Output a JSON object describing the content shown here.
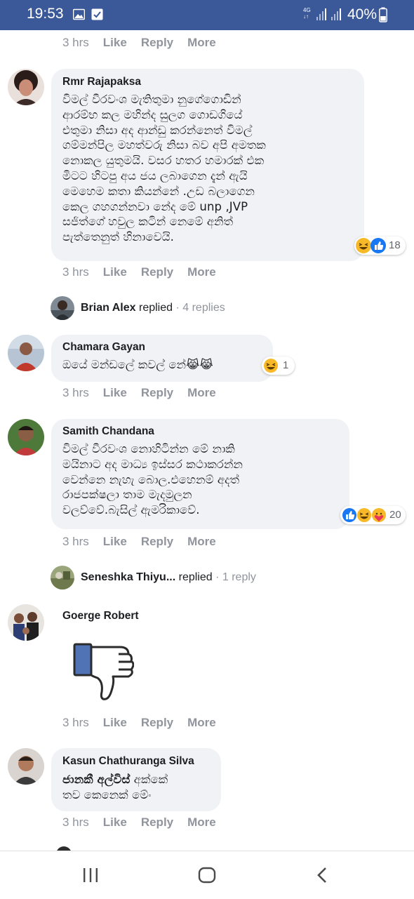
{
  "status_bar": {
    "time": "19:53",
    "network": "4G",
    "battery": "40%",
    "icons": [
      "gallery-icon",
      "check-notification-icon",
      "signal-icon",
      "battery-icon"
    ]
  },
  "top_actions": {
    "time": "3 hrs",
    "like": "Like",
    "reply": "Reply",
    "more": "More"
  },
  "comments": [
    {
      "name": "Rmr Rajapaksa",
      "text": "විමල් වීරවංශ මැතිතුමා නුගේගොඩින්\nආරම්භ කල මහින්ද සුලග ගොඩගියේ\nඑතුමා නිසා අද ආන්ඩු කරන්නෙත් විමල්\nගම්මන්පිල මහත්වරු නිසා බව අපි අමතක\nනොකල යුතුමයි. වසර හතර හමාරක් එක\nමිටට හිටපු අය ජය ලබාගෙන දැන් ඇයි\nමෙහෙම කතා කියන්නේ .උඩ බලාගෙන\nකෙල ගහගන්නවා නේද මේ unp ,JVP\nසජිත්ගේ හවුල කටින් නෙමේ අනිත්\nපැත්තෙනුත් හිනාවෙයි.",
      "reaction_count": "18",
      "reactions": [
        "haha",
        "like"
      ],
      "time": "3 hrs",
      "like": "Like",
      "reply": "Reply",
      "more": "More"
    },
    {
      "name": "Chamara Gayan",
      "text": "ඔයේ මන්ඩලේ කවල් නේ😹😹",
      "reaction_count": "1",
      "reactions": [
        "haha"
      ],
      "time": "3 hrs",
      "like": "Like",
      "reply": "Reply",
      "more": "More"
    },
    {
      "name": "Samith Chandana",
      "text": "විමල් වීරවංශ නොහිටින්න මේ නාකි\nමයිනාට අද මාධ්‍ය ඉස්සර කථාකරන්න\nවෙන්නෙ නැහැ බොල.එහෙනම් අදත්\nරාජපක්ෂලා තාම මැදමුලන\nවලව්වේ.බැසිල් ඇමරිකාවේ.",
      "reaction_count": "20",
      "reactions": [
        "like",
        "haha",
        "care"
      ],
      "time": "3 hrs",
      "like": "Like",
      "reply": "Reply",
      "more": "More"
    },
    {
      "name": "Goerge Robert",
      "text": "",
      "sticker": "dislike-thumb-sticker",
      "time": "3 hrs",
      "like": "Like",
      "reply": "Reply",
      "more": "More"
    },
    {
      "name": "Kasun Chathuranga Silva",
      "text_bold": "ජානකී අල්විස්",
      "text": " අක්කේ\nතව කෙනෙක් මේං",
      "time": "3 hrs",
      "like": "Like",
      "reply": "Reply",
      "more": "More"
    }
  ],
  "reply_threads": [
    {
      "name": "Brian Alex",
      "replied": "replied",
      "count": "· 4 replies"
    },
    {
      "name": "Seneshka Thiyu...",
      "replied": "replied",
      "count": "· 1 reply"
    }
  ],
  "nav": {
    "icons": [
      "recent-apps-icon",
      "home-icon",
      "back-icon"
    ]
  },
  "colors": {
    "statusbar": "#3b5998",
    "bubble": "#f0f2f5",
    "meta": "#90949c",
    "like_blue": "#1877f2",
    "haha_yellow": "#f7b928"
  }
}
